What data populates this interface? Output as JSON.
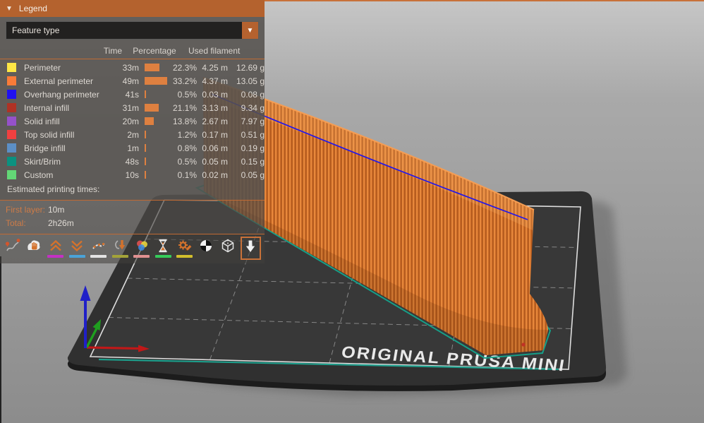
{
  "legend": {
    "title": "Legend",
    "collapse_icon": "▼",
    "feature_selector": {
      "value": "Feature type",
      "arrow": "▼"
    },
    "table": {
      "headers": {
        "time": "Time",
        "percentage": "Percentage",
        "used_filament": "Used filament"
      },
      "bar_color": "#de8040",
      "rows": [
        {
          "label": "Perimeter",
          "color": "#fde645",
          "time": "33m",
          "pct": 22.3,
          "percent": "22.3%",
          "length": "4.25 m",
          "weight": "12.69 g"
        },
        {
          "label": "External perimeter",
          "color": "#f97b38",
          "time": "49m",
          "pct": 33.2,
          "percent": "33.2%",
          "length": "4.37 m",
          "weight": "13.05 g"
        },
        {
          "label": "Overhang perimeter",
          "color": "#2011f0",
          "time": "41s",
          "pct": 0.5,
          "percent": "0.5%",
          "length": "0.03 m",
          "weight": "0.08 g"
        },
        {
          "label": "Internal infill",
          "color": "#af3225",
          "time": "31m",
          "pct": 21.1,
          "percent": "21.1%",
          "length": "3.13 m",
          "weight": "9.34 g"
        },
        {
          "label": "Solid infill",
          "color": "#9551c9",
          "time": "20m",
          "pct": 13.8,
          "percent": "13.8%",
          "length": "2.67 m",
          "weight": "7.97 g"
        },
        {
          "label": "Top solid infill",
          "color": "#f04040",
          "time": "2m",
          "pct": 1.2,
          "percent": "1.2%",
          "length": "0.17 m",
          "weight": "0.51 g"
        },
        {
          "label": "Bridge infill",
          "color": "#5c8fc6",
          "time": "1m",
          "pct": 0.8,
          "percent": "0.8%",
          "length": "0.06 m",
          "weight": "0.19 g"
        },
        {
          "label": "Skirt/Brim",
          "color": "#0b9180",
          "time": "48s",
          "pct": 0.5,
          "percent": "0.5%",
          "length": "0.05 m",
          "weight": "0.15 g"
        },
        {
          "label": "Custom",
          "color": "#63d776",
          "time": "10s",
          "pct": 0.1,
          "percent": "0.1%",
          "length": "0.02 m",
          "weight": "0.05 g"
        }
      ]
    },
    "times": {
      "heading": "Estimated printing times:",
      "first_layer_label": "First layer:",
      "first_layer_value": "10m",
      "total_label": "Total:",
      "total_value": "2h26m"
    },
    "toolbar": {
      "icons": [
        {
          "name": "travels",
          "underline": null
        },
        {
          "name": "wipe",
          "underline": null
        },
        {
          "name": "retractions",
          "underline": "#c430c4"
        },
        {
          "name": "deretractions",
          "underline": "#4aa3d8"
        },
        {
          "name": "seams",
          "underline": "#e4e4e4"
        },
        {
          "name": "tool-changes",
          "underline": "#a3a339"
        },
        {
          "name": "color-changes",
          "underline": "#e09090"
        },
        {
          "name": "pause-prints",
          "underline": "#35cb5a"
        },
        {
          "name": "custom-gcodes",
          "underline": "#d2be2c"
        },
        {
          "name": "center-of-gravity",
          "underline": null
        },
        {
          "name": "shells",
          "underline": null
        },
        {
          "name": "legend-toggle",
          "underline": null
        }
      ]
    }
  },
  "scene": {
    "bed_text": "ORIGINAL PRUSA MINI",
    "object_color": "#d4712b",
    "overhang_line_color": "#2317e8",
    "skirt_color": "#16a089",
    "axis_colors": {
      "x": "#c01818",
      "y": "#1f9e1f",
      "z": "#2020c8"
    }
  }
}
